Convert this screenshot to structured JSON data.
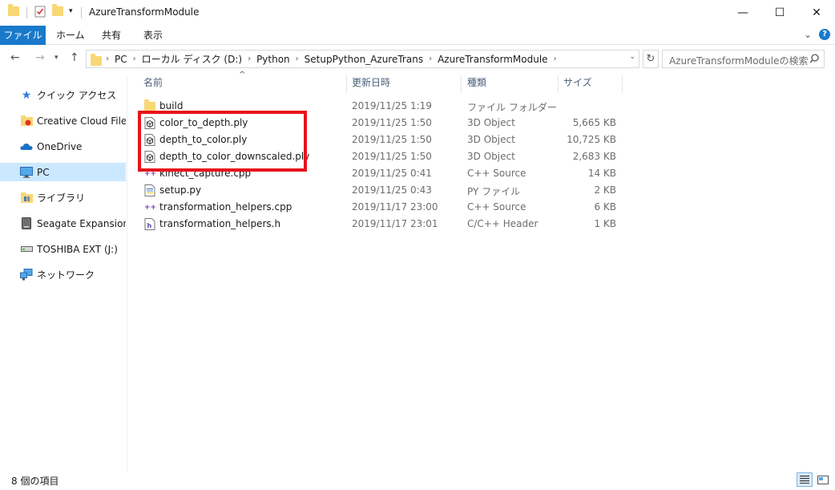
{
  "window": {
    "title": "AzureTransformModule",
    "controls": {
      "minimize": "—",
      "maximize": "☐",
      "close": "✕"
    }
  },
  "ribbon": {
    "tabs": [
      "ファイル",
      "ホーム",
      "共有",
      "表示"
    ],
    "expand_glyph": "⌄",
    "help_glyph": "?"
  },
  "address_bar": {
    "breadcrumbs": [
      "PC",
      "ローカル ディスク (D:)",
      "Python",
      "SetupPython_AzureTrans",
      "AzureTransformModule"
    ]
  },
  "search": {
    "placeholder": "AzureTransformModuleの検索"
  },
  "nav_pane": {
    "items": [
      {
        "label": "クイック アクセス",
        "icon": "quick-access-star-icon"
      },
      {
        "label": "Creative Cloud Files",
        "icon": "creative-cloud-icon"
      },
      {
        "label": "OneDrive",
        "icon": "onedrive-cloud-icon"
      },
      {
        "label": "PC",
        "icon": "pc-monitor-icon",
        "selected": true
      },
      {
        "label": "ライブラリ",
        "icon": "library-icon"
      },
      {
        "label": "Seagate Expansion Dr",
        "icon": "external-drive-icon"
      },
      {
        "label": "TOSHIBA EXT (J:)",
        "icon": "drive-icon"
      },
      {
        "label": "ネットワーク",
        "icon": "network-icon"
      }
    ]
  },
  "file_list": {
    "columns": [
      "名前",
      "更新日時",
      "種類",
      "サイズ"
    ],
    "rows": [
      {
        "name": "build",
        "date": "2019/11/25 1:19",
        "type": "ファイル フォルダー",
        "size": "",
        "icon": "folder-icon"
      },
      {
        "name": "color_to_depth.ply",
        "date": "2019/11/25 1:50",
        "type": "3D Object",
        "size": "5,665 KB",
        "icon": "3d-object-icon"
      },
      {
        "name": "depth_to_color.ply",
        "date": "2019/11/25 1:50",
        "type": "3D Object",
        "size": "10,725 KB",
        "icon": "3d-object-icon"
      },
      {
        "name": "depth_to_color_downscaled.ply",
        "date": "2019/11/25 1:50",
        "type": "3D Object",
        "size": "2,683 KB",
        "icon": "3d-object-icon"
      },
      {
        "name": "kinect_capture.cpp",
        "date": "2019/11/25 0:41",
        "type": "C++ Source",
        "size": "14 KB",
        "icon": "cpp-source-icon"
      },
      {
        "name": "setup.py",
        "date": "2019/11/25 0:43",
        "type": "PY ファイル",
        "size": "2 KB",
        "icon": "python-file-icon"
      },
      {
        "name": "transformation_helpers.cpp",
        "date": "2019/11/17 23:00",
        "type": "C++ Source",
        "size": "6 KB",
        "icon": "cpp-source-icon"
      },
      {
        "name": "transformation_helpers.h",
        "date": "2019/11/17 23:01",
        "type": "C/C++ Header",
        "size": "1 KB",
        "icon": "header-file-icon"
      }
    ]
  },
  "status_bar": {
    "item_count": "8 個の項目"
  },
  "colors": {
    "accent": "#1979ca",
    "selection": "#cce8ff",
    "highlight_box": "#e8141b",
    "header_text": "#4c607a"
  }
}
